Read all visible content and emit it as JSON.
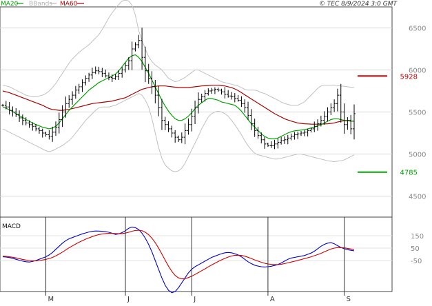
{
  "header": {
    "legend": [
      {
        "label": "MA20",
        "color": "#00a000",
        "text_color": "#00a000"
      },
      {
        "label": "BBands",
        "color": "#bbbbbb",
        "text_color": "#b0b0b0"
      },
      {
        "label": "MA60",
        "color": "#aa0000",
        "text_color": "#aa0000"
      }
    ],
    "copyright": "© TEC 8/9/2024 3:0 GMT"
  },
  "chart_data": [
    {
      "type": "ohlc",
      "name": "price",
      "ylim": [
        4250,
        6750
      ],
      "y_ticks": [
        {
          "value": 6500,
          "label": "6500"
        },
        {
          "value": 6000,
          "label": "6000"
        },
        {
          "value": 5500,
          "label": "5500"
        },
        {
          "value": 5000,
          "label": "5000"
        },
        {
          "value": 4500,
          "label": "4500"
        }
      ],
      "x_labels": [
        {
          "index": 13,
          "label": "M"
        },
        {
          "index": 37,
          "label": "J"
        },
        {
          "index": 57,
          "label": "J"
        },
        {
          "index": 80,
          "label": "A"
        },
        {
          "index": 103,
          "label": "S"
        }
      ],
      "n_bars": 107,
      "closes": [
        5580,
        5560,
        5520,
        5500,
        5470,
        5430,
        5400,
        5370,
        5350,
        5330,
        5300,
        5280,
        5250,
        5230,
        5210,
        5260,
        5320,
        5410,
        5500,
        5600,
        5650,
        5700,
        5760,
        5800,
        5850,
        5900,
        5940,
        5970,
        5990,
        5980,
        5960,
        5930,
        5910,
        5900,
        5920,
        5960,
        6000,
        6050,
        6110,
        6250,
        6300,
        6350,
        6150,
        5990,
        5900,
        5800,
        5700,
        5550,
        5400,
        5350,
        5300,
        5250,
        5200,
        5170,
        5200,
        5280,
        5350,
        5450,
        5550,
        5650,
        5680,
        5720,
        5750,
        5760,
        5770,
        5760,
        5740,
        5710,
        5690,
        5680,
        5660,
        5640,
        5600,
        5550,
        5460,
        5360,
        5280,
        5220,
        5170,
        5120,
        5100,
        5100,
        5120,
        5140,
        5160,
        5170,
        5190,
        5210,
        5230,
        5240,
        5250,
        5260,
        5280,
        5300,
        5330,
        5360,
        5400,
        5450,
        5500,
        5550,
        5600,
        5700,
        5500,
        5350,
        5400,
        5300,
        5480
      ],
      "ma20": [
        5560,
        5545,
        5525,
        5505,
        5480,
        5455,
        5435,
        5410,
        5390,
        5370,
        5350,
        5335,
        5320,
        5310,
        5300,
        5310,
        5330,
        5370,
        5420,
        5470,
        5520,
        5560,
        5600,
        5640,
        5680,
        5720,
        5760,
        5790,
        5820,
        5850,
        5870,
        5890,
        5910,
        5930,
        5950,
        5990,
        6040,
        6090,
        6140,
        6170,
        6180,
        6150,
        6100,
        6030,
        5960,
        5880,
        5800,
        5720,
        5640,
        5570,
        5510,
        5460,
        5420,
        5400,
        5400,
        5420,
        5450,
        5490,
        5540,
        5580,
        5610,
        5640,
        5660,
        5660,
        5650,
        5640,
        5620,
        5610,
        5600,
        5590,
        5580,
        5550,
        5510,
        5460,
        5410,
        5360,
        5320,
        5280,
        5240,
        5210,
        5190,
        5180,
        5180,
        5190,
        5210,
        5230,
        5250,
        5265,
        5275,
        5280,
        5285,
        5290,
        5300,
        5310,
        5320,
        5335,
        5350,
        5370,
        5390,
        5410,
        5420,
        5420,
        5410,
        5400,
        5400,
        5390,
        5390
      ],
      "ma60": [
        5750,
        5740,
        5730,
        5715,
        5700,
        5685,
        5670,
        5655,
        5640,
        5625,
        5610,
        5595,
        5580,
        5560,
        5540,
        5530,
        5525,
        5520,
        5520,
        5525,
        5530,
        5540,
        5550,
        5560,
        5570,
        5580,
        5590,
        5600,
        5605,
        5610,
        5615,
        5620,
        5625,
        5630,
        5640,
        5650,
        5660,
        5670,
        5690,
        5710,
        5730,
        5750,
        5770,
        5780,
        5790,
        5800,
        5805,
        5810,
        5810,
        5810,
        5805,
        5800,
        5795,
        5790,
        5790,
        5790,
        5790,
        5795,
        5800,
        5805,
        5810,
        5812,
        5815,
        5817,
        5818,
        5818,
        5815,
        5810,
        5800,
        5790,
        5775,
        5755,
        5730,
        5705,
        5680,
        5655,
        5630,
        5605,
        5580,
        5555,
        5530,
        5505,
        5480,
        5460,
        5440,
        5420,
        5405,
        5392,
        5380,
        5370,
        5365,
        5360,
        5358,
        5356,
        5355,
        5355,
        5356,
        5358,
        5360,
        5365,
        5370,
        5380,
        5390,
        5395,
        5395,
        5392,
        5390
      ],
      "bb_upper": [
        5820,
        5810,
        5800,
        5780,
        5760,
        5740,
        5720,
        5700,
        5690,
        5680,
        5680,
        5690,
        5700,
        5720,
        5750,
        5790,
        5840,
        5900,
        5960,
        6020,
        6080,
        6130,
        6170,
        6210,
        6240,
        6270,
        6300,
        6340,
        6380,
        6420,
        6480,
        6550,
        6620,
        6680,
        6730,
        6780,
        6820,
        6830,
        6820,
        6770,
        6650,
        6470,
        6350,
        6250,
        6160,
        6100,
        6060,
        6030,
        6000,
        5950,
        5900,
        5880,
        5860,
        5870,
        5890,
        5910,
        5940,
        5970,
        6000,
        6000,
        5980,
        5960,
        5940,
        5920,
        5900,
        5880,
        5860,
        5850,
        5840,
        5830,
        5820,
        5810,
        5790,
        5770,
        5760,
        5760,
        5760,
        5750,
        5730,
        5720,
        5700,
        5680,
        5660,
        5640,
        5620,
        5600,
        5590,
        5580,
        5580,
        5580,
        5600,
        5620,
        5660,
        5700,
        5740,
        5780,
        5810,
        5820,
        5820,
        5820,
        5820,
        5815,
        5810,
        5805,
        5800,
        5795,
        5790
      ],
      "bb_lower": [
        5300,
        5280,
        5260,
        5240,
        5220,
        5200,
        5180,
        5160,
        5140,
        5120,
        5100,
        5080,
        5060,
        5040,
        5030,
        5040,
        5060,
        5080,
        5100,
        5130,
        5160,
        5200,
        5250,
        5300,
        5350,
        5400,
        5440,
        5480,
        5520,
        5550,
        5560,
        5560,
        5560,
        5570,
        5580,
        5600,
        5620,
        5640,
        5660,
        5680,
        5700,
        5720,
        5700,
        5640,
        5560,
        5420,
        5250,
        5080,
        4950,
        4870,
        4830,
        4800,
        4790,
        4800,
        4830,
        4890,
        4970,
        5050,
        5130,
        5210,
        5300,
        5370,
        5440,
        5480,
        5500,
        5510,
        5500,
        5480,
        5450,
        5400,
        5350,
        5290,
        5230,
        5160,
        5100,
        5050,
        5010,
        4990,
        4980,
        4970,
        4960,
        4950,
        4940,
        4940,
        4950,
        4960,
        4970,
        4980,
        4990,
        5000,
        5000,
        4990,
        4980,
        4970,
        4960,
        4950,
        4940,
        4930,
        4920,
        4915,
        4910,
        4915,
        4920,
        4930,
        4950,
        4970,
        4990
      ],
      "levels": [
        {
          "value": 5928,
          "label": "5928",
          "color": "#cc0000"
        },
        {
          "value": 4785,
          "label": "4785",
          "color": "#00a000"
        }
      ]
    },
    {
      "type": "line",
      "name": "MACD",
      "title": "MACD",
      "ylim": [
        -300,
        300
      ],
      "y_ticks": [
        {
          "value": 150,
          "label": "150"
        },
        {
          "value": 50,
          "label": "50"
        },
        {
          "value": -50,
          "label": "-50"
        }
      ],
      "series": [
        {
          "name": "macd",
          "color": "#0000cc",
          "values": [
            -20,
            -22,
            -26,
            -32,
            -40,
            -48,
            -55,
            -60,
            -62,
            -58,
            -50,
            -40,
            -30,
            -20,
            -5,
            15,
            40,
            65,
            90,
            110,
            125,
            135,
            145,
            155,
            165,
            172,
            180,
            185,
            188,
            187,
            185,
            182,
            178,
            170,
            160,
            165,
            175,
            190,
            210,
            220,
            215,
            200,
            170,
            130,
            80,
            20,
            -50,
            -120,
            -190,
            -250,
            -290,
            -310,
            -300,
            -270,
            -230,
            -190,
            -150,
            -120,
            -100,
            -85,
            -70,
            -55,
            -40,
            -25,
            -15,
            -5,
            5,
            12,
            15,
            12,
            5,
            -5,
            -20,
            -40,
            -60,
            -75,
            -88,
            -95,
            -100,
            -102,
            -100,
            -96,
            -90,
            -82,
            -70,
            -55,
            -40,
            -30,
            -25,
            -20,
            -15,
            -10,
            0,
            10,
            25,
            45,
            65,
            80,
            90,
            95,
            85,
            70,
            55,
            45,
            38,
            32,
            28
          ]
        },
        {
          "name": "signal",
          "color": "#cc0000",
          "values": [
            -15,
            -17,
            -20,
            -24,
            -29,
            -35,
            -41,
            -46,
            -50,
            -52,
            -52,
            -50,
            -46,
            -41,
            -34,
            -25,
            -12,
            2,
            18,
            35,
            52,
            68,
            83,
            97,
            110,
            122,
            133,
            143,
            152,
            159,
            164,
            167,
            169,
            169,
            167,
            166,
            167,
            171,
            178,
            186,
            192,
            194,
            190,
            178,
            158,
            130,
            94,
            51,
            3,
            -48,
            -96,
            -138,
            -170,
            -190,
            -198,
            -196,
            -188,
            -176,
            -162,
            -147,
            -132,
            -117,
            -101,
            -86,
            -72,
            -58,
            -45,
            -33,
            -22,
            -14,
            -8,
            -7,
            -9,
            -15,
            -24,
            -34,
            -45,
            -55,
            -64,
            -72,
            -78,
            -81,
            -83,
            -83,
            -80,
            -75,
            -69,
            -62,
            -56,
            -49,
            -42,
            -35,
            -28,
            -20,
            -11,
            -2,
            8,
            20,
            31,
            42,
            50,
            54,
            54,
            52,
            48,
            43,
            38
          ]
        }
      ]
    }
  ]
}
